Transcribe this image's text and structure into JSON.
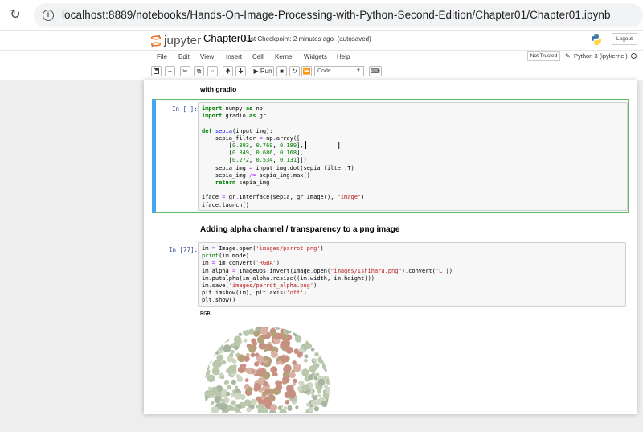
{
  "browser": {
    "url": "localhost:8889/notebooks/Hands-On-Image-Processing-with-Python-Second-Edition/Chapter01/Chapter01.ipynb"
  },
  "header": {
    "logo_text": "jupyter",
    "notebook_name": "Chapter01",
    "checkpoint": "Last Checkpoint: 2 minutes ago",
    "autosave": "(autosaved)",
    "logout_label": "Logout"
  },
  "menu": {
    "items": [
      "File",
      "Edit",
      "View",
      "Insert",
      "Cell",
      "Kernel",
      "Widgets",
      "Help"
    ],
    "trust_label": "Not Trusted",
    "kernel_label": "Python 3 (ipykernel)"
  },
  "toolbar": {
    "run_label": "Run",
    "cell_type": "Code"
  },
  "cells": {
    "md1": "with gradio",
    "code1_prompt": "In [ ]:",
    "md2": "Adding alpha channel / transparency to a png image",
    "code2_prompt": "In [77]:",
    "output_text": "RGB"
  },
  "colors": {
    "selected_border": "#66bb6a",
    "selected_bar": "#42a5f5",
    "prompt": "#303f9f"
  }
}
